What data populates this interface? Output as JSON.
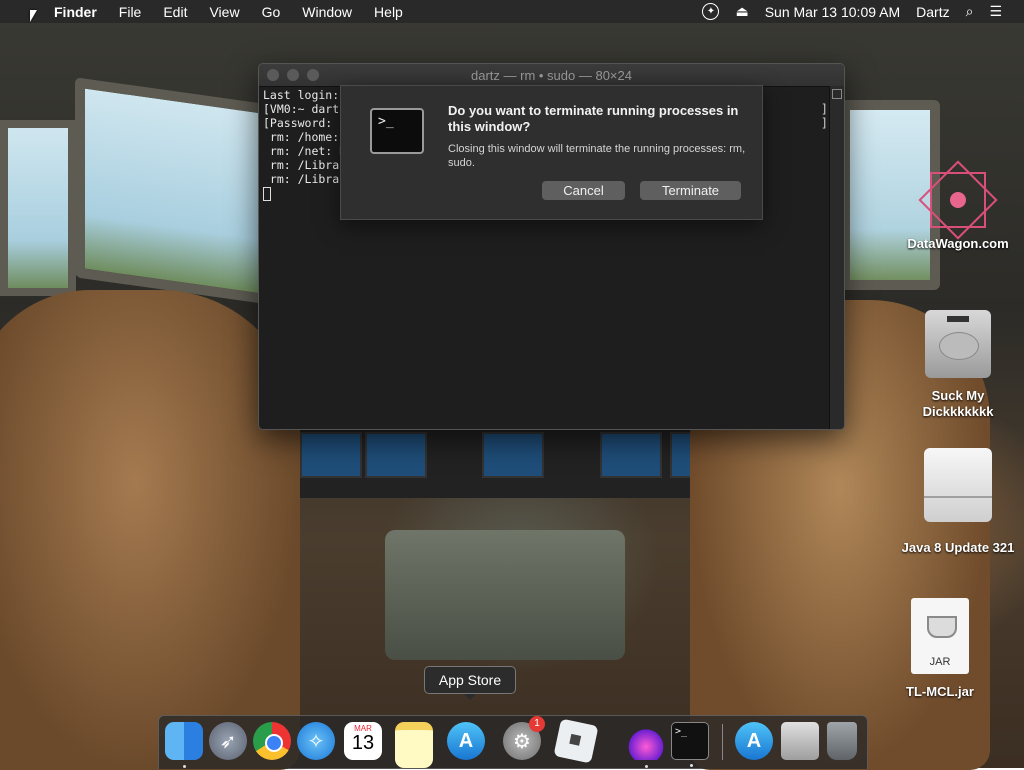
{
  "menubar": {
    "app_name": "Finder",
    "items": [
      "File",
      "Edit",
      "View",
      "Go",
      "Window",
      "Help"
    ],
    "clock": "Sun Mar 13  10:09 AM",
    "user": "Dartz"
  },
  "terminal": {
    "title": "dartz — rm • sudo — 80×24",
    "lines": [
      "Last login:",
      "[VM0:~ dartz",
      "[Password:",
      " rm: /home:",
      " rm: /net: R",
      " rm: /Librar",
      " rm: /Librar"
    ]
  },
  "alert": {
    "title": "Do you want to terminate running processes in this window?",
    "message": "Closing this window will terminate the running processes: rm, sudo.",
    "cancel_label": "Cancel",
    "terminate_label": "Terminate"
  },
  "desktop": {
    "icons": [
      {
        "label": "DataWagon.com"
      },
      {
        "label": "Suck My Dickkkkkkk"
      },
      {
        "label": "Java 8 Update 321"
      },
      {
        "label": "TL-MCL.jar"
      }
    ],
    "jar_caption": "JAR"
  },
  "dock": {
    "tooltip": "App Store",
    "calendar_month": "MAR",
    "calendar_day": "13",
    "sysprefs_badge": "1"
  }
}
